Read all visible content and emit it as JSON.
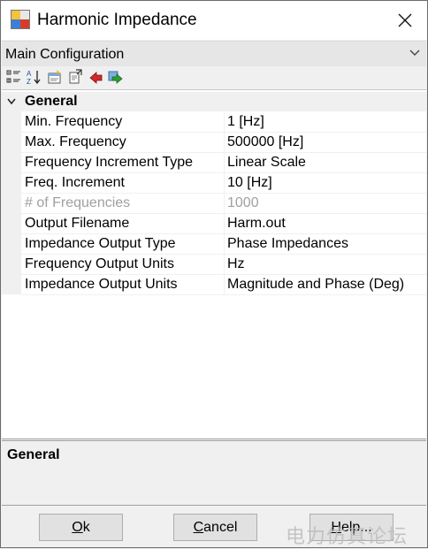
{
  "window": {
    "title": "Harmonic Impedance"
  },
  "config": {
    "selected": "Main Configuration"
  },
  "toolbar": {
    "buttons": [
      "categorized-icon",
      "alphabetical-icon",
      "property-pages-icon",
      "export-icon",
      "red-arrow-icon",
      "green-arrow-icon"
    ]
  },
  "grid": {
    "category": "General",
    "rows": [
      {
        "name": "Min. Frequency",
        "value": "1 [Hz]",
        "readonly": false
      },
      {
        "name": "Max. Frequency",
        "value": "500000 [Hz]",
        "readonly": false
      },
      {
        "name": "Frequency Increment Type",
        "value": "Linear Scale",
        "readonly": false
      },
      {
        "name": "Freq. Increment",
        "value": "10 [Hz]",
        "readonly": false
      },
      {
        "name": "# of Frequencies",
        "value": "1000",
        "readonly": true
      },
      {
        "name": "Output Filename",
        "value": "Harm.out",
        "readonly": false
      },
      {
        "name": "Impedance Output Type",
        "value": "Phase Impedances",
        "readonly": false
      },
      {
        "name": "Frequency Output Units",
        "value": "Hz",
        "readonly": false
      },
      {
        "name": "Impedance Output Units",
        "value": "Magnitude and Phase (Deg)",
        "readonly": false
      }
    ]
  },
  "description": {
    "title": "General"
  },
  "buttons": {
    "ok": {
      "mnemonic": "O",
      "rest": "k"
    },
    "cancel": {
      "mnemonic": "C",
      "rest": "ancel"
    },
    "help": {
      "mnemonic": "H",
      "rest": "elp..."
    }
  },
  "watermark": "电力仿真论坛",
  "colors": {
    "readonly_text": "#a0a0a0",
    "category_bg": "#f0f0f0"
  }
}
